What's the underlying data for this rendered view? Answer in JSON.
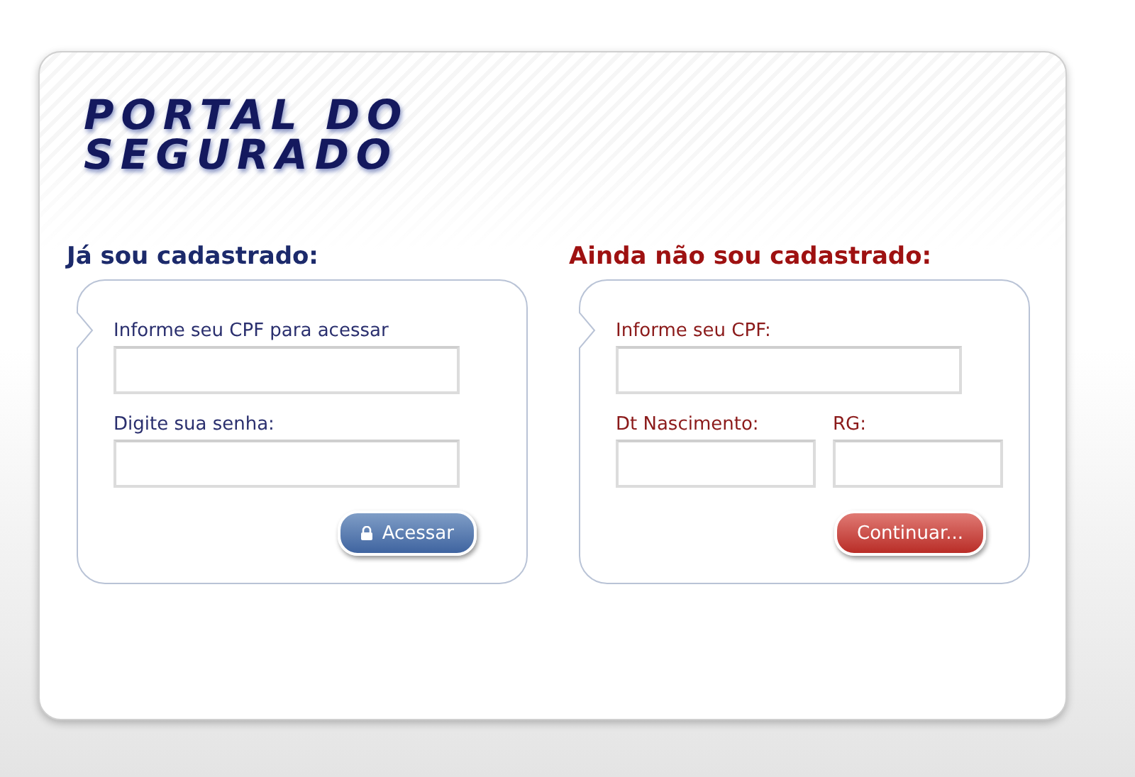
{
  "logo": {
    "lines": [
      "PORTAL DO",
      "SEGURADO"
    ]
  },
  "panels": [
    {
      "kind": "login",
      "heading": "Já sou cadastrado:",
      "rows": [
        [
          {
            "label": "Informe seu CPF para acessar"
          }
        ],
        [
          {
            "label": "Digite sua senha:"
          }
        ]
      ],
      "button": {
        "label": "Acessar"
      }
    },
    {
      "kind": "register",
      "heading": "Ainda não sou cadastrado:",
      "rows": [
        [
          {
            "label": "Informe seu CPF:"
          }
        ],
        [
          {
            "label": "Dt Nascimento:"
          },
          {
            "label": "RG:"
          }
        ]
      ],
      "button": {
        "label": "Continuar..."
      }
    }
  ]
}
